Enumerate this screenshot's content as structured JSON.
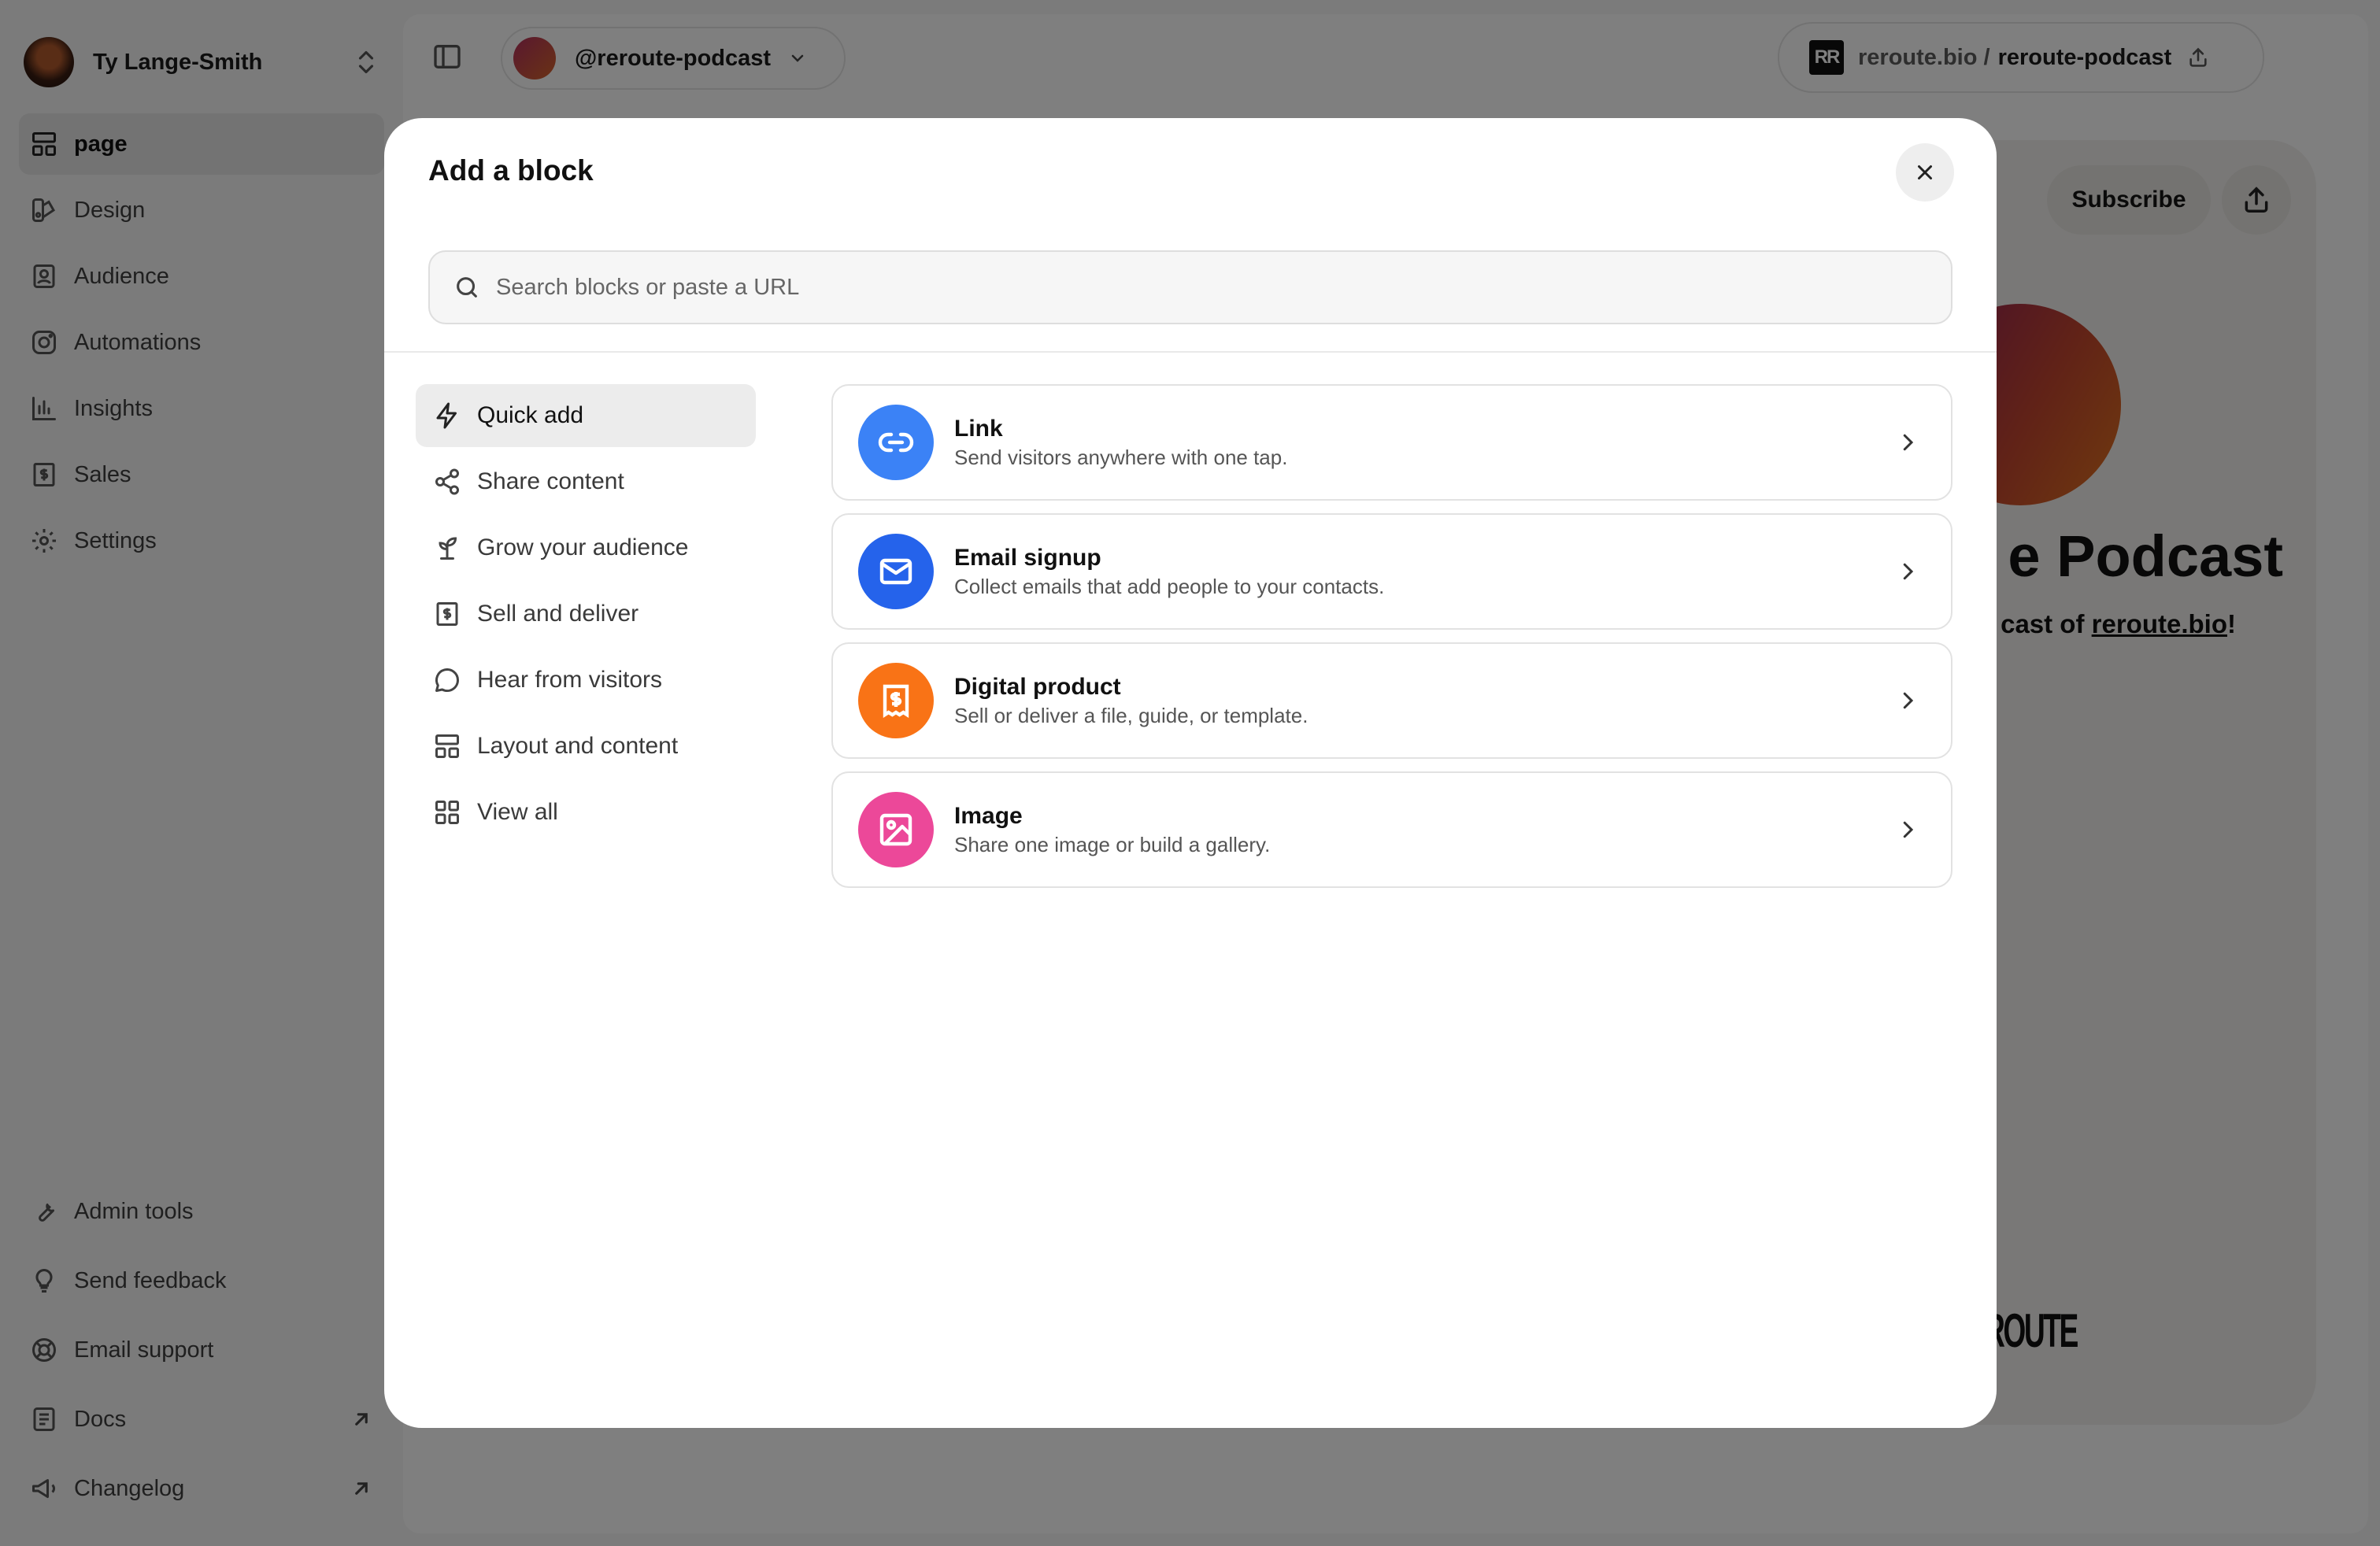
{
  "sidebar": {
    "user_name": "Ty Lange-Smith",
    "items": [
      {
        "label": "page",
        "icon": "layout-icon"
      },
      {
        "label": "Design",
        "icon": "palette-icon"
      },
      {
        "label": "Audience",
        "icon": "contacts-icon"
      },
      {
        "label": "Automations",
        "icon": "instagram-icon"
      },
      {
        "label": "Insights",
        "icon": "bar-chart-icon"
      },
      {
        "label": "Sales",
        "icon": "receipt-dollar-icon"
      },
      {
        "label": "Settings",
        "icon": "gear-icon"
      }
    ],
    "footer_items": [
      {
        "label": "Admin tools",
        "icon": "wrench-icon"
      },
      {
        "label": "Send feedback",
        "icon": "lightbulb-icon"
      },
      {
        "label": "Email support",
        "icon": "lifebuoy-icon"
      },
      {
        "label": "Docs",
        "icon": "document-icon"
      },
      {
        "label": "Changelog",
        "icon": "megaphone-icon"
      }
    ]
  },
  "topbar": {
    "handle": "@reroute-podcast",
    "url_domain": "reroute.bio /",
    "url_slug": "reroute-podcast",
    "logo_text": "RR"
  },
  "preview": {
    "subscribe_label": "Subscribe",
    "title_fragment": "e Podcast",
    "subtitle_fragment": "cast of",
    "subtitle_link": "reroute.bio",
    "subtitle_end": "!",
    "wordmark": "ROUTE"
  },
  "modal": {
    "title": "Add a block",
    "search_placeholder": "Search blocks or paste a URL",
    "categories": [
      {
        "label": "Quick add",
        "icon": "lightning-icon"
      },
      {
        "label": "Share content",
        "icon": "share-icon"
      },
      {
        "label": "Grow your audience",
        "icon": "sprout-icon"
      },
      {
        "label": "Sell and deliver",
        "icon": "receipt-dollar-icon"
      },
      {
        "label": "Hear from visitors",
        "icon": "chat-bubble-icon"
      },
      {
        "label": "Layout and content",
        "icon": "layout-icon"
      },
      {
        "label": "View all",
        "icon": "grid-icon"
      }
    ],
    "blocks": [
      {
        "title": "Link",
        "description": "Send visitors anywhere with one tap.",
        "icon": "link-icon",
        "color": "#3b82f6"
      },
      {
        "title": "Email signup",
        "description": "Collect emails that add people to your contacts.",
        "icon": "envelope-icon",
        "color": "#2563eb"
      },
      {
        "title": "Digital product",
        "description": "Sell or deliver a file, guide, or template.",
        "icon": "receipt-dollar-icon",
        "color": "#f97316"
      },
      {
        "title": "Image",
        "description": "Share one image or build a gallery.",
        "icon": "image-icon",
        "color": "#ec4899"
      }
    ]
  },
  "colors": {
    "overlay": "rgba(0,0,0,0.5)",
    "active_bg": "#ececec"
  }
}
